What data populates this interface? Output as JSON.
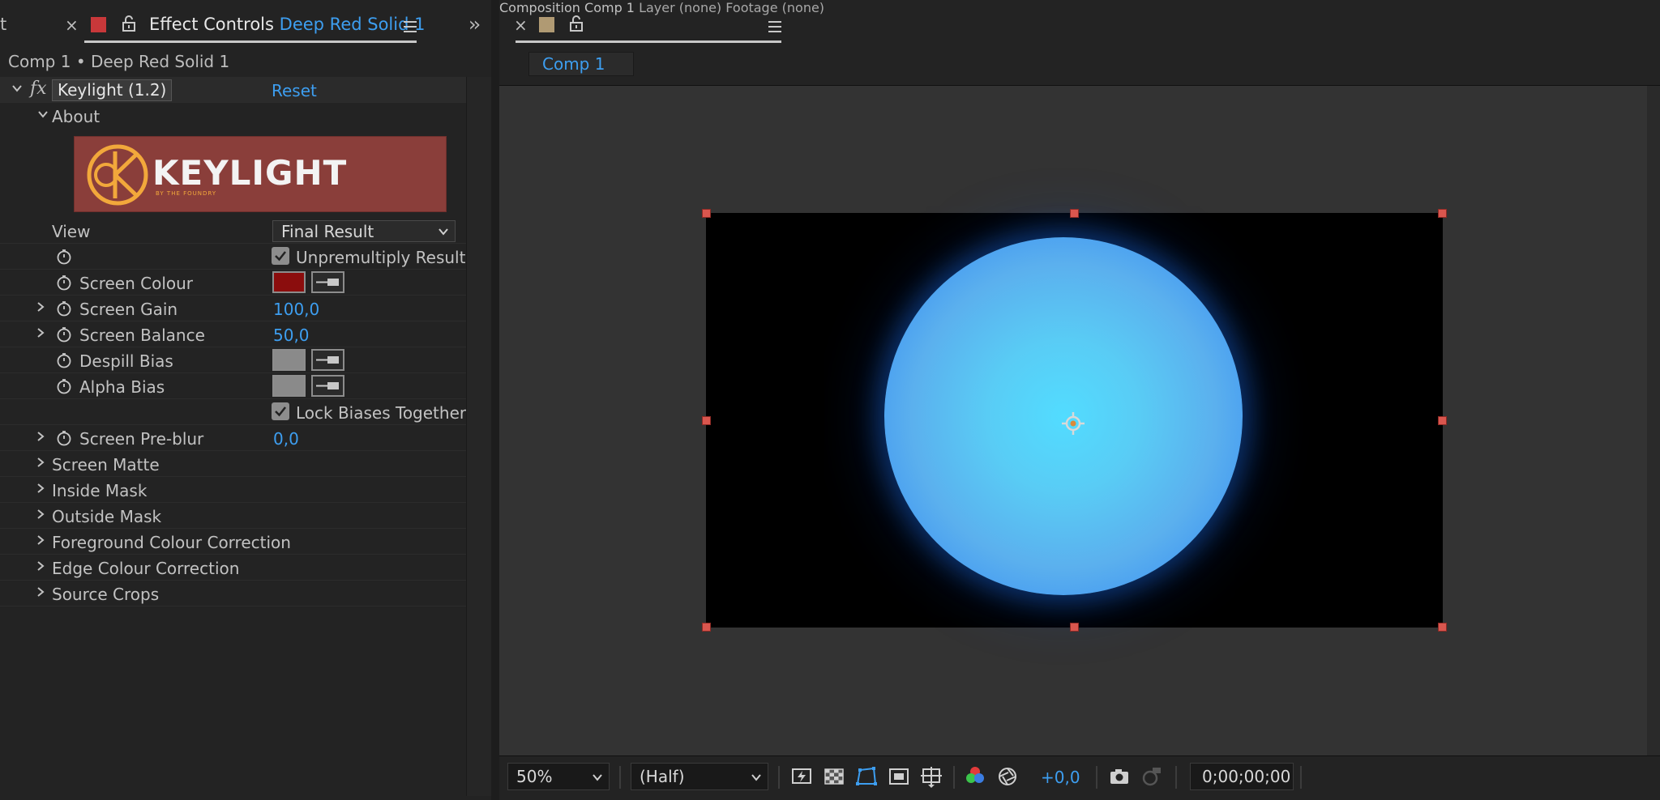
{
  "colors": {
    "accent_blue": "#3d9ef0",
    "solid_red": "#c8383a",
    "footage_tan": "#b09a73",
    "screen_colour": "#8b0d0d",
    "despill_bias": "#8a8a8a",
    "alpha_bias": "#8a8a8a"
  },
  "left_panel": {
    "cut_tab_fragment": "t",
    "effect_controls_tab": {
      "title": "Effect Controls",
      "layer": "Deep Red Solid 1"
    },
    "breadcrumb": "Comp 1 • Deep Red Solid 1",
    "effect": {
      "fx_badge": "fx",
      "name": "Keylight (1.2)",
      "reset_label": "Reset"
    },
    "about_label": "About",
    "logo": {
      "text": "KEYLIGHT",
      "subtitle": "BY THE FOUNDRY"
    },
    "view": {
      "label": "View",
      "value": "Final Result"
    },
    "unpremultiply": {
      "label": "Unpremultiply Result",
      "checked": true
    },
    "screen_colour_label": "Screen Colour",
    "screen_gain": {
      "label": "Screen Gain",
      "value": "100,0"
    },
    "screen_balance": {
      "label": "Screen Balance",
      "value": "50,0"
    },
    "despill_bias_label": "Despill Bias",
    "alpha_bias_label": "Alpha Bias",
    "lock_biases": {
      "label": "Lock Biases Together",
      "checked": true
    },
    "screen_preblur": {
      "label": "Screen Pre-blur",
      "value": "0,0"
    },
    "groups": [
      "Screen Matte",
      "Inside Mask",
      "Outside Mask",
      "Foreground Colour Correction",
      "Edge Colour Correction",
      "Source Crops"
    ]
  },
  "right_panel": {
    "composition_tab": {
      "title": "Composition",
      "comp": "Comp 1"
    },
    "layer_tab": "Layer (none)",
    "footage_tab": "Footage (none)",
    "comp_chip": "Comp 1",
    "footer": {
      "zoom": "50%",
      "resolution": "(Half)",
      "exposure": "+0,0",
      "timecode": "0;00;00;00"
    },
    "icons": [
      "fast-previews-icon",
      "transparency-grid-icon",
      "mask-path-visibility-icon",
      "region-of-interest-icon",
      "grid-guides-icon",
      "channel-rgb-icon",
      "reset-exposure-icon",
      "snapshot-camera-icon",
      "show-snapshot-icon"
    ]
  }
}
